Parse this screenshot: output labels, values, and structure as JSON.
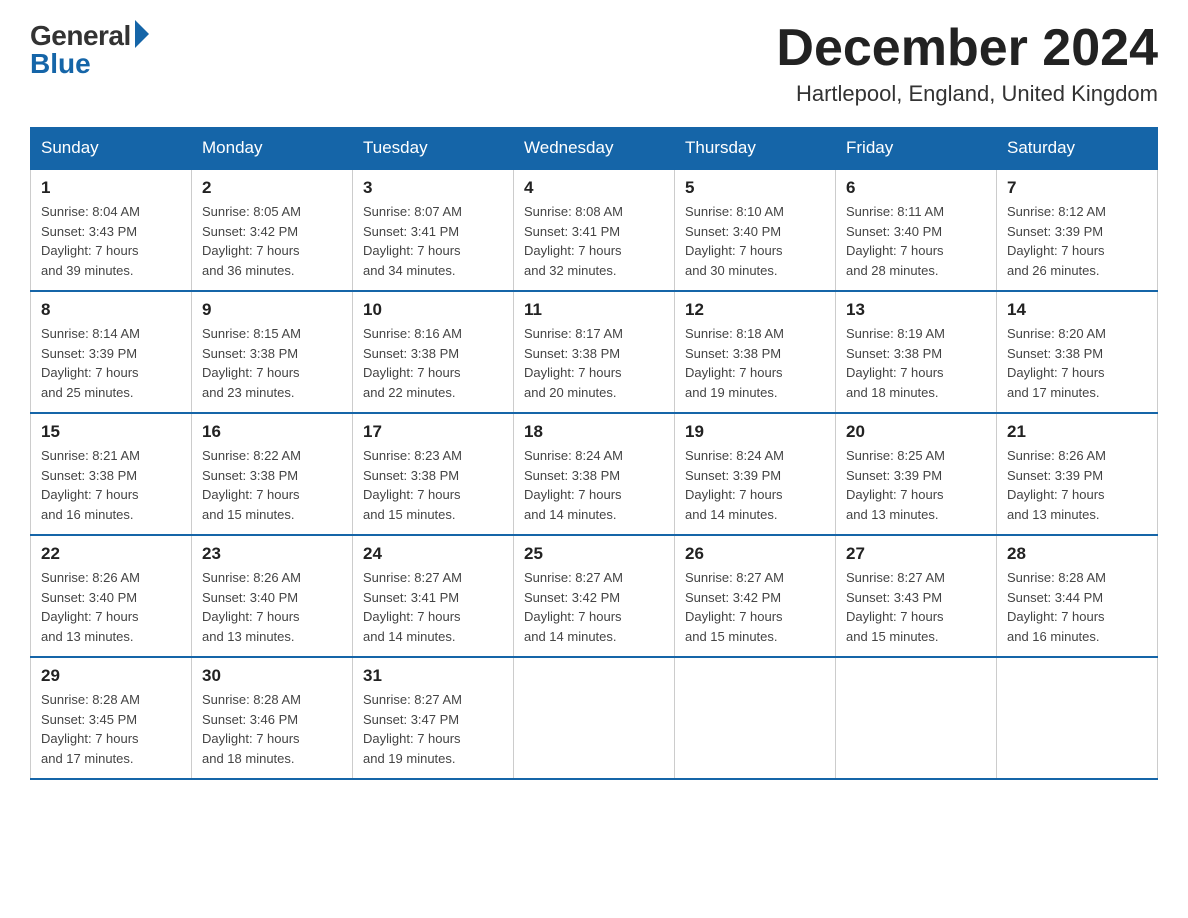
{
  "header": {
    "logo_general": "General",
    "logo_blue": "Blue",
    "month_title": "December 2024",
    "location": "Hartlepool, England, United Kingdom"
  },
  "weekdays": [
    "Sunday",
    "Monday",
    "Tuesday",
    "Wednesday",
    "Thursday",
    "Friday",
    "Saturday"
  ],
  "weeks": [
    [
      {
        "day": "1",
        "sunrise": "8:04 AM",
        "sunset": "3:43 PM",
        "daylight": "7 hours and 39 minutes."
      },
      {
        "day": "2",
        "sunrise": "8:05 AM",
        "sunset": "3:42 PM",
        "daylight": "7 hours and 36 minutes."
      },
      {
        "day": "3",
        "sunrise": "8:07 AM",
        "sunset": "3:41 PM",
        "daylight": "7 hours and 34 minutes."
      },
      {
        "day": "4",
        "sunrise": "8:08 AM",
        "sunset": "3:41 PM",
        "daylight": "7 hours and 32 minutes."
      },
      {
        "day": "5",
        "sunrise": "8:10 AM",
        "sunset": "3:40 PM",
        "daylight": "7 hours and 30 minutes."
      },
      {
        "day": "6",
        "sunrise": "8:11 AM",
        "sunset": "3:40 PM",
        "daylight": "7 hours and 28 minutes."
      },
      {
        "day": "7",
        "sunrise": "8:12 AM",
        "sunset": "3:39 PM",
        "daylight": "7 hours and 26 minutes."
      }
    ],
    [
      {
        "day": "8",
        "sunrise": "8:14 AM",
        "sunset": "3:39 PM",
        "daylight": "7 hours and 25 minutes."
      },
      {
        "day": "9",
        "sunrise": "8:15 AM",
        "sunset": "3:38 PM",
        "daylight": "7 hours and 23 minutes."
      },
      {
        "day": "10",
        "sunrise": "8:16 AM",
        "sunset": "3:38 PM",
        "daylight": "7 hours and 22 minutes."
      },
      {
        "day": "11",
        "sunrise": "8:17 AM",
        "sunset": "3:38 PM",
        "daylight": "7 hours and 20 minutes."
      },
      {
        "day": "12",
        "sunrise": "8:18 AM",
        "sunset": "3:38 PM",
        "daylight": "7 hours and 19 minutes."
      },
      {
        "day": "13",
        "sunrise": "8:19 AM",
        "sunset": "3:38 PM",
        "daylight": "7 hours and 18 minutes."
      },
      {
        "day": "14",
        "sunrise": "8:20 AM",
        "sunset": "3:38 PM",
        "daylight": "7 hours and 17 minutes."
      }
    ],
    [
      {
        "day": "15",
        "sunrise": "8:21 AM",
        "sunset": "3:38 PM",
        "daylight": "7 hours and 16 minutes."
      },
      {
        "day": "16",
        "sunrise": "8:22 AM",
        "sunset": "3:38 PM",
        "daylight": "7 hours and 15 minutes."
      },
      {
        "day": "17",
        "sunrise": "8:23 AM",
        "sunset": "3:38 PM",
        "daylight": "7 hours and 15 minutes."
      },
      {
        "day": "18",
        "sunrise": "8:24 AM",
        "sunset": "3:38 PM",
        "daylight": "7 hours and 14 minutes."
      },
      {
        "day": "19",
        "sunrise": "8:24 AM",
        "sunset": "3:39 PM",
        "daylight": "7 hours and 14 minutes."
      },
      {
        "day": "20",
        "sunrise": "8:25 AM",
        "sunset": "3:39 PM",
        "daylight": "7 hours and 13 minutes."
      },
      {
        "day": "21",
        "sunrise": "8:26 AM",
        "sunset": "3:39 PM",
        "daylight": "7 hours and 13 minutes."
      }
    ],
    [
      {
        "day": "22",
        "sunrise": "8:26 AM",
        "sunset": "3:40 PM",
        "daylight": "7 hours and 13 minutes."
      },
      {
        "day": "23",
        "sunrise": "8:26 AM",
        "sunset": "3:40 PM",
        "daylight": "7 hours and 13 minutes."
      },
      {
        "day": "24",
        "sunrise": "8:27 AM",
        "sunset": "3:41 PM",
        "daylight": "7 hours and 14 minutes."
      },
      {
        "day": "25",
        "sunrise": "8:27 AM",
        "sunset": "3:42 PM",
        "daylight": "7 hours and 14 minutes."
      },
      {
        "day": "26",
        "sunrise": "8:27 AM",
        "sunset": "3:42 PM",
        "daylight": "7 hours and 15 minutes."
      },
      {
        "day": "27",
        "sunrise": "8:27 AM",
        "sunset": "3:43 PM",
        "daylight": "7 hours and 15 minutes."
      },
      {
        "day": "28",
        "sunrise": "8:28 AM",
        "sunset": "3:44 PM",
        "daylight": "7 hours and 16 minutes."
      }
    ],
    [
      {
        "day": "29",
        "sunrise": "8:28 AM",
        "sunset": "3:45 PM",
        "daylight": "7 hours and 17 minutes."
      },
      {
        "day": "30",
        "sunrise": "8:28 AM",
        "sunset": "3:46 PM",
        "daylight": "7 hours and 18 minutes."
      },
      {
        "day": "31",
        "sunrise": "8:27 AM",
        "sunset": "3:47 PM",
        "daylight": "7 hours and 19 minutes."
      },
      null,
      null,
      null,
      null
    ]
  ]
}
